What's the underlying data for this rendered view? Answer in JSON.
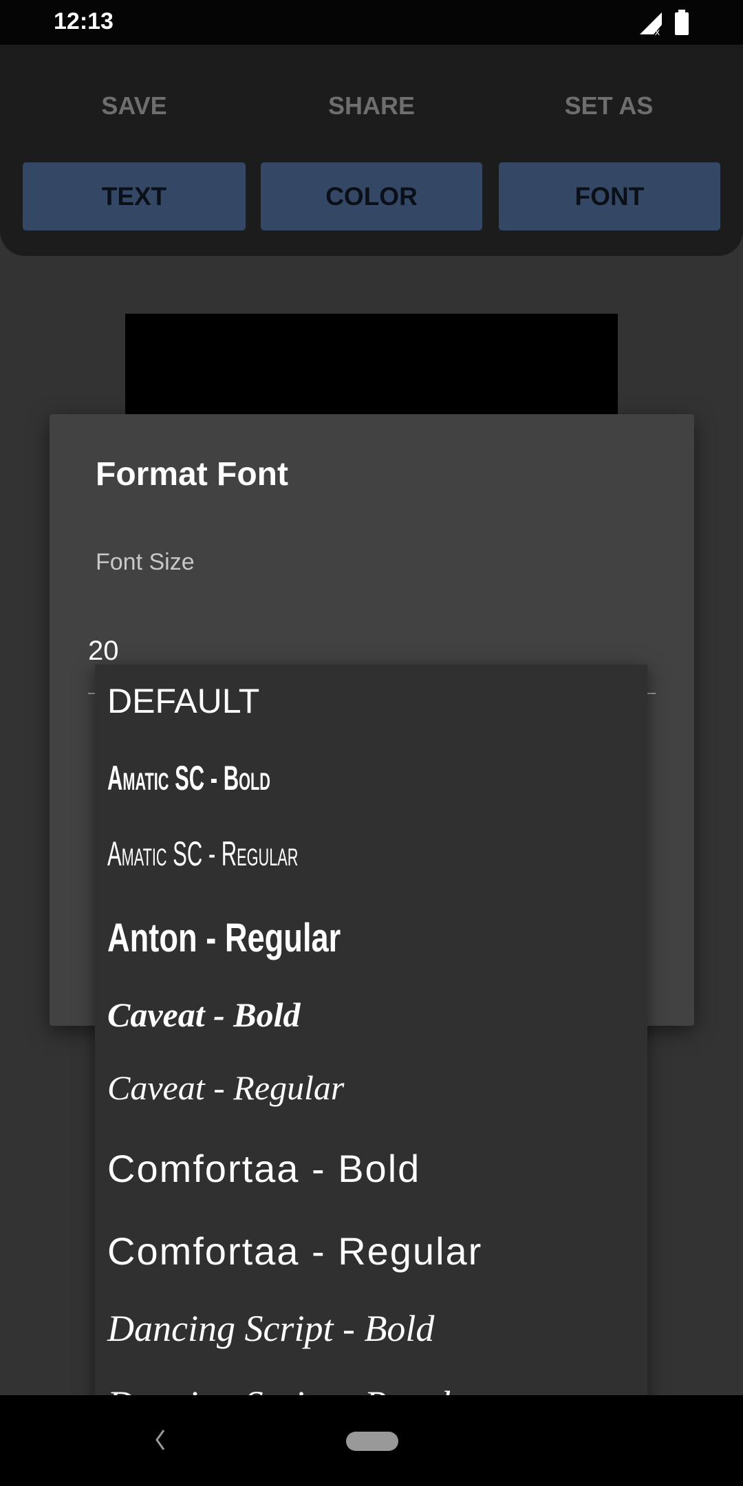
{
  "status_bar": {
    "time": "12:13",
    "icons": [
      "signal-no-data-icon",
      "battery-icon"
    ]
  },
  "toolbar": {
    "actions": [
      "SAVE",
      "SHARE",
      "SET AS"
    ],
    "tabs": [
      "TEXT",
      "COLOR",
      "FONT"
    ],
    "tab_color": "#344866"
  },
  "dialog": {
    "title": "Format Font",
    "font_size_label": "Font Size",
    "font_size_value": "20"
  },
  "font_dropdown": {
    "options": [
      "DEFAULT",
      "Amatic SC - Bold",
      "Amatic SC - Regular",
      "Anton - Regular",
      "Caveat - Bold",
      "Caveat - Regular",
      "Comfortaa - Bold",
      "Comfortaa - Regular",
      "Dancing Script - Bold",
      "Dancing Script - Regular"
    ]
  },
  "nav_bar": {
    "icons": [
      "back-icon",
      "home-icon"
    ]
  }
}
